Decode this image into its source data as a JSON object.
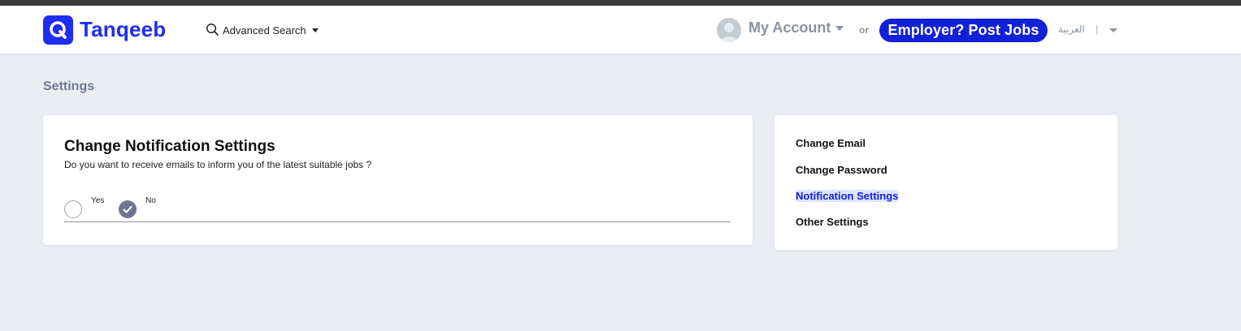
{
  "header": {
    "logo_text": "Tanqeeb",
    "advanced_search": "Advanced Search",
    "my_account": "My Account",
    "or": "or",
    "post_jobs": "Employer? Post Jobs",
    "language": "العربية",
    "separator": "|"
  },
  "page": {
    "title": "Settings"
  },
  "notification_card": {
    "title": "Change Notification Settings",
    "question": "Do you want to receive emails to inform you of the latest suitable jobs ?",
    "options": [
      {
        "label": "Yes",
        "selected": false
      },
      {
        "label": "No",
        "selected": true
      }
    ]
  },
  "settings_menu": {
    "items": [
      {
        "label": "Change Email",
        "active": false
      },
      {
        "label": "Change Password",
        "active": false
      },
      {
        "label": "Notification Settings",
        "active": true
      },
      {
        "label": "Other Settings",
        "active": false
      }
    ]
  },
  "colors": {
    "brand": "#1f2df0",
    "button": "#1221d8",
    "background": "#eaeef3",
    "muted": "#8a93a3",
    "radio_selected": "#6f7490"
  }
}
